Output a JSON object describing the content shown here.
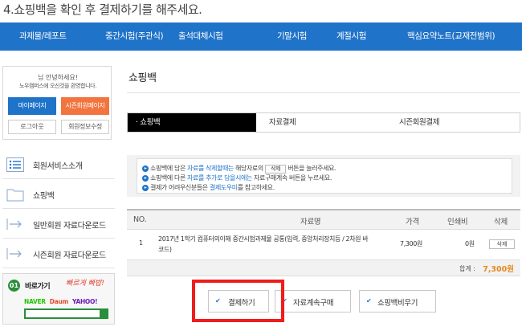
{
  "step_title": "4.쇼핑백을 확인 후 결제하기를 해주세요.",
  "nav": {
    "items": [
      "과제물/레포트",
      "중간시험(주관식)",
      "출석대체시험",
      "기말시험",
      "계절시험",
      "핵심요약노트(교재전범위)"
    ]
  },
  "login": {
    "greeting": "님 안녕하세요!",
    "welcome": "노우캠퍼스에 오신것을 환영합니다.",
    "mypage": "마이페이지",
    "season_page": "시즌회원페이지",
    "logout": "로그아웃",
    "modify": "회원정보수정"
  },
  "side_menu": {
    "items": [
      "회원서비스소개",
      "쇼핑백",
      "일반회원 자료다운로드",
      "시즌회원 자료다운로드"
    ]
  },
  "shortcut": {
    "num": "01",
    "title": "바로가기",
    "hand": "빠르게 빠밥!",
    "naver": "NAVER",
    "daum": "Daum",
    "yahoo": "YAHOO!"
  },
  "main": {
    "title": "쇼핑백",
    "tabs": [
      "· 쇼핑백",
      "자료결제",
      "시즌회원결제"
    ]
  },
  "notice": {
    "l1a": "쇼핑백에 담은 ",
    "l1b": "자료를 삭제할때는",
    "l1c": " 해당자료의 ",
    "l1chip": "삭제",
    "l1d": " 버튼을 눌러주세요.",
    "l2a": "쇼핑백에 다른 ",
    "l2b": "자료를 추가로 담을시에는",
    "l2c": " 자료구매계속 버튼을 누르세요.",
    "l3a": "결제가 어려우신분들은 ",
    "l3b": "결제도우미",
    "l3c": "를 참고하세요."
  },
  "table": {
    "headers": [
      "NO.",
      "자료명",
      "가격",
      "인쇄비",
      "삭제"
    ],
    "rows": [
      {
        "no": "1",
        "name_line1": "2017년 1학기 컴퓨터의이해 중간시험과제물 공통(입력, 중앙처리장치등 / 2차원 바",
        "name_line2": "코드)",
        "price": "7,300원",
        "print_fee": "0원",
        "delete": "삭제"
      }
    ],
    "total_label": "합계 :",
    "total_value": "7,300원"
  },
  "actions": {
    "pay": "결제하기",
    "continue": "자료계속구매",
    "empty": "쇼핑백비우기"
  },
  "colors": {
    "brand_blue": "#1f73c9",
    "accent_orange": "#f2743e",
    "highlight_red": "#ee1c1c",
    "total_orange": "#e58a1f"
  }
}
